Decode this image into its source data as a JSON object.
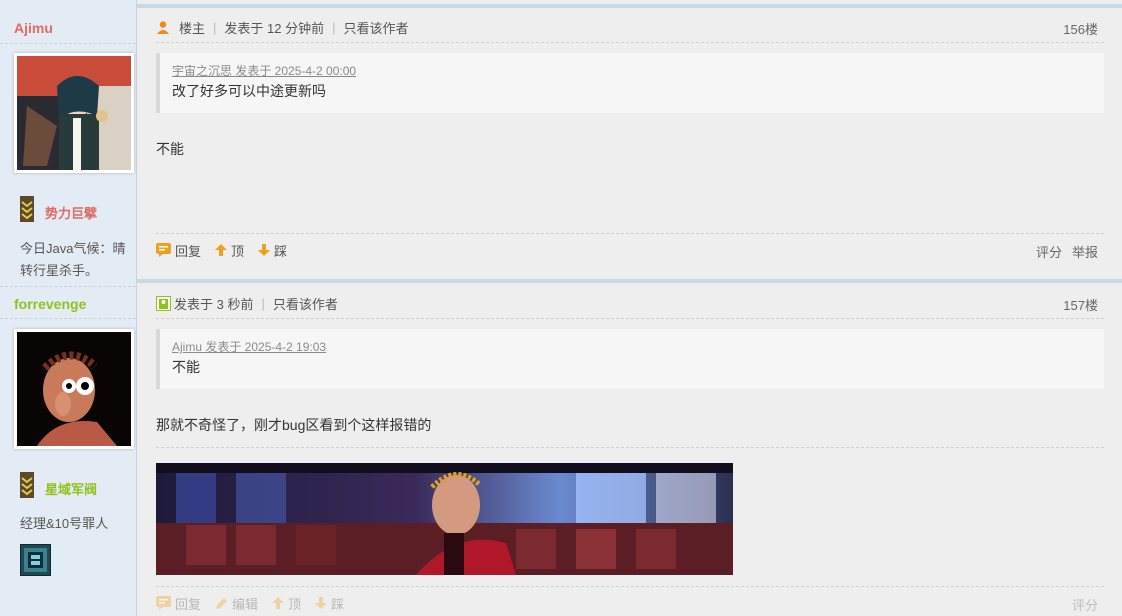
{
  "users": [
    {
      "name": "Ajimu",
      "name_color": "#e06b62",
      "rank": "势力巨擘",
      "rank_color": "#e06b62",
      "signature": "今日Java气候：晴转行星杀手。"
    },
    {
      "name": "forrevenge",
      "name_color": "#8fc21a",
      "rank": "星域军阀",
      "rank_color": "#8fc21a",
      "signature": "经理&10号罪人"
    }
  ],
  "posts": [
    {
      "badge": "楼主",
      "posted": "发表于 12 分钟前",
      "only_author": "只看该作者",
      "floor": "156楼",
      "quote_attr": "宇宙之沉思 发表于 2025-4-2 00:00",
      "quote_text": "改了好多可以中途更新吗",
      "content": "不能",
      "actions": {
        "reply": "回复",
        "up": "顶",
        "down": "踩"
      },
      "right_actions": {
        "rate": "评分",
        "report": "举报"
      }
    },
    {
      "posted": "发表于 3 秒前",
      "only_author": "只看该作者",
      "floor": "157楼",
      "quote_attr": "Ajimu 发表于 2025-4-2 19:03",
      "quote_text": "不能",
      "content": "那就不奇怪了，刚才bug区看到个这样报错的",
      "actions": {
        "reply": "回复",
        "edit": "编辑",
        "up": "顶",
        "down": "踩"
      },
      "right_actions": {
        "rate": "评分"
      }
    }
  ],
  "colors": {
    "accent": "#f0a020",
    "quote_bg": "#f6f6f6",
    "sidebar_bg": "#e3ecf4"
  }
}
